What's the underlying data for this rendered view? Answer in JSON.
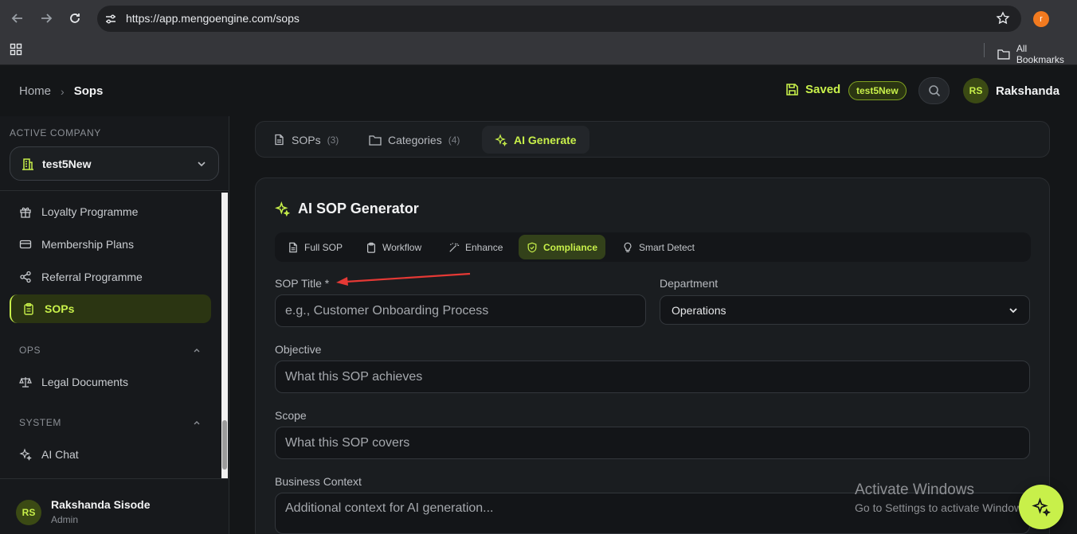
{
  "browser": {
    "url": "https://app.mengoengine.com/sops",
    "profile_initial": "r",
    "bookmarks_label": "All Bookmarks"
  },
  "header": {
    "breadcrumb_home": "Home",
    "breadcrumb_sep": "›",
    "breadcrumb_current": "Sops",
    "saved_label": "Saved",
    "company_badge": "test5New",
    "user_initials": "RS",
    "user_name": "Rakshanda"
  },
  "sidebar": {
    "active_company_label": "ACTIVE COMPANY",
    "company_name": "test5New",
    "items": [
      {
        "label": "Loyalty Programme",
        "icon": "gift-icon"
      },
      {
        "label": "Membership Plans",
        "icon": "card-icon"
      },
      {
        "label": "Referral Programme",
        "icon": "share-icon"
      },
      {
        "label": "SOPs",
        "icon": "clipboard-icon",
        "active": true
      }
    ],
    "groups": [
      {
        "label": "OPS",
        "items": [
          {
            "label": "Legal Documents",
            "icon": "scale-icon"
          }
        ]
      },
      {
        "label": "SYSTEM",
        "items": [
          {
            "label": "AI Chat",
            "icon": "sparkle-icon"
          }
        ]
      }
    ],
    "user": {
      "initials": "RS",
      "name": "Rakshanda Sisode",
      "role": "Admin"
    }
  },
  "tabs": [
    {
      "label": "SOPs",
      "count": "(3)"
    },
    {
      "label": "Categories",
      "count": "(4)"
    },
    {
      "label": "AI Generate",
      "active": true
    }
  ],
  "generator": {
    "title": "AI SOP Generator",
    "modes": [
      {
        "label": "Full SOP"
      },
      {
        "label": "Workflow"
      },
      {
        "label": "Enhance"
      },
      {
        "label": "Compliance",
        "active": true
      },
      {
        "label": "Smart Detect"
      }
    ],
    "fields": {
      "title_label": "SOP Title *",
      "title_placeholder": "e.g., Customer Onboarding Process",
      "department_label": "Department",
      "department_value": "Operations",
      "objective_label": "Objective",
      "objective_placeholder": "What this SOP achieves",
      "scope_label": "Scope",
      "scope_placeholder": "What this SOP covers",
      "context_label": "Business Context",
      "context_placeholder": "Additional context for AI generation..."
    }
  },
  "watermark": {
    "line1": "Activate Windows",
    "line2": "Go to Settings to activate Windows."
  },
  "colors": {
    "accent": "#c8f04a",
    "background": "#141618",
    "annotation_arrow": "#e53935"
  }
}
